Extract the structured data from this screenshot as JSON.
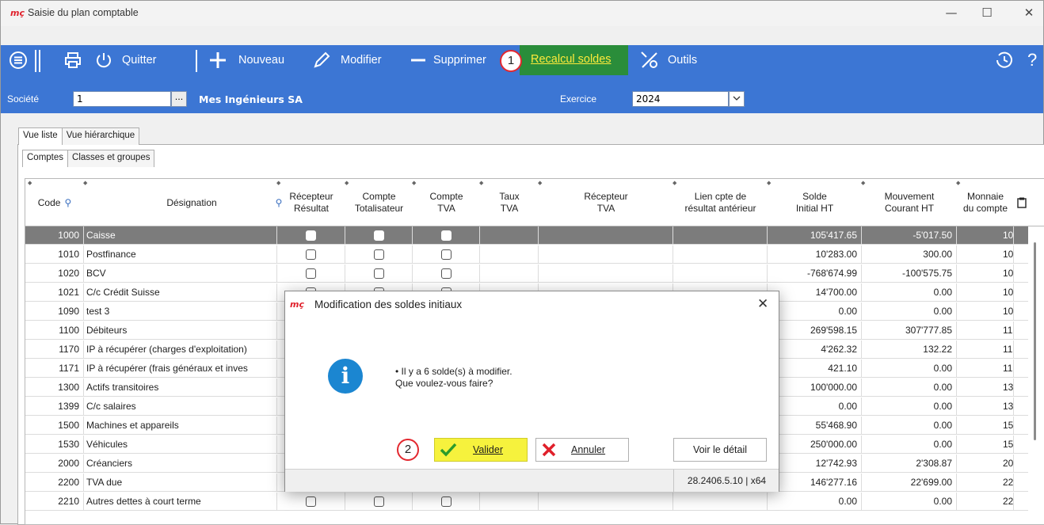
{
  "window": {
    "logo": "mç",
    "title": "Saisie du plan comptable",
    "minimize": "—",
    "maximize": "☐",
    "close": "✕"
  },
  "toolbar": {
    "quit": "Quitter",
    "new": "Nouveau",
    "modify": "Modifier",
    "delete": "Supprimer",
    "recalc": "Recalcul soldes",
    "tools": "Outils"
  },
  "society": {
    "label": "Société",
    "value": "1",
    "browse": "...",
    "name": "Mes Ingénieurs SA",
    "exercice_label": "Exercice",
    "exercice_value": "2024"
  },
  "tabs": [
    "Vue liste",
    "Vue hiérarchique"
  ],
  "subtabs": [
    "Comptes",
    "Classes et groupes"
  ],
  "columns": {
    "code": "Code",
    "designation": "Désignation",
    "recepteur_resultat": "Récepteur\nRésultat",
    "compte_totalisateur": "Compte\nTotalisateur",
    "compte_tva": "Compte\nTVA",
    "taux_tva": "Taux\nTVA",
    "recepteur_tva": "Récepteur\nTVA",
    "lien": "Lien cpte de\nrésultat antérieur",
    "solde": "Solde\nInitial HT",
    "mouvement": "Mouvement\nCourant HT",
    "monnaie": "Monnaie\ndu compte"
  },
  "rows": [
    {
      "code": "1000",
      "name": "Caisse",
      "solde": "105'417.65",
      "mouv": "-5'017.50",
      "mon": "10",
      "selected": true
    },
    {
      "code": "1010",
      "name": "Postfinance",
      "solde": "10'283.00",
      "mouv": "300.00",
      "mon": "10"
    },
    {
      "code": "1020",
      "name": "BCV",
      "solde": "-768'674.99",
      "mouv": "-100'575.75",
      "mon": "10"
    },
    {
      "code": "1021",
      "name": "C/c Crédit Suisse",
      "solde": "14'700.00",
      "mouv": "0.00",
      "mon": "10"
    },
    {
      "code": "1090",
      "name": "test 3",
      "solde": "0.00",
      "mouv": "0.00",
      "mon": "10"
    },
    {
      "code": "1100",
      "name": "Débiteurs",
      "solde": "269'598.15",
      "mouv": "307'777.85",
      "mon": "11"
    },
    {
      "code": "1170",
      "name": "IP à récupérer (charges d'exploitation)",
      "solde": "4'262.32",
      "mouv": "132.22",
      "mon": "11"
    },
    {
      "code": "1171",
      "name": "IP à récupérer (frais généraux et inves",
      "solde": "421.10",
      "mouv": "0.00",
      "mon": "11"
    },
    {
      "code": "1300",
      "name": "Actifs transitoires",
      "solde": "100'000.00",
      "mouv": "0.00",
      "mon": "13"
    },
    {
      "code": "1399",
      "name": "C/c salaires",
      "solde": "0.00",
      "mouv": "0.00",
      "mon": "13"
    },
    {
      "code": "1500",
      "name": "Machines et appareils",
      "solde": "55'468.90",
      "mouv": "0.00",
      "mon": "15"
    },
    {
      "code": "1530",
      "name": "Véhicules",
      "solde": "250'000.00",
      "mouv": "0.00",
      "mon": "15"
    },
    {
      "code": "2000",
      "name": "Créanciers",
      "solde": "12'742.93",
      "mouv": "2'308.87",
      "mon": "20"
    },
    {
      "code": "2200",
      "name": "TVA due",
      "solde": "146'277.16",
      "mouv": "22'699.00",
      "mon": "22",
      "tva_checked": true
    },
    {
      "code": "2210",
      "name": "Autres dettes à court terme",
      "solde": "0.00",
      "mouv": "0.00",
      "mon": "22"
    }
  ],
  "dialog": {
    "logo": "mç",
    "title": "Modification des soldes initiaux",
    "close": "✕",
    "icon": "i",
    "message_line1": "• Il y a 6 solde(s) à modifier.",
    "message_line2": "Que voulez-vous  faire?",
    "validate": "Valider",
    "cancel": "Annuler",
    "detail": "Voir le détail",
    "version": "28.2406.5.10 | x64"
  },
  "badges": {
    "one": "1",
    "two": "2"
  },
  "colors": {
    "toolbar": "#3c76d4",
    "highlight": "#2a8d3a",
    "badge": "#e3282f",
    "validate": "#f6f23d"
  }
}
